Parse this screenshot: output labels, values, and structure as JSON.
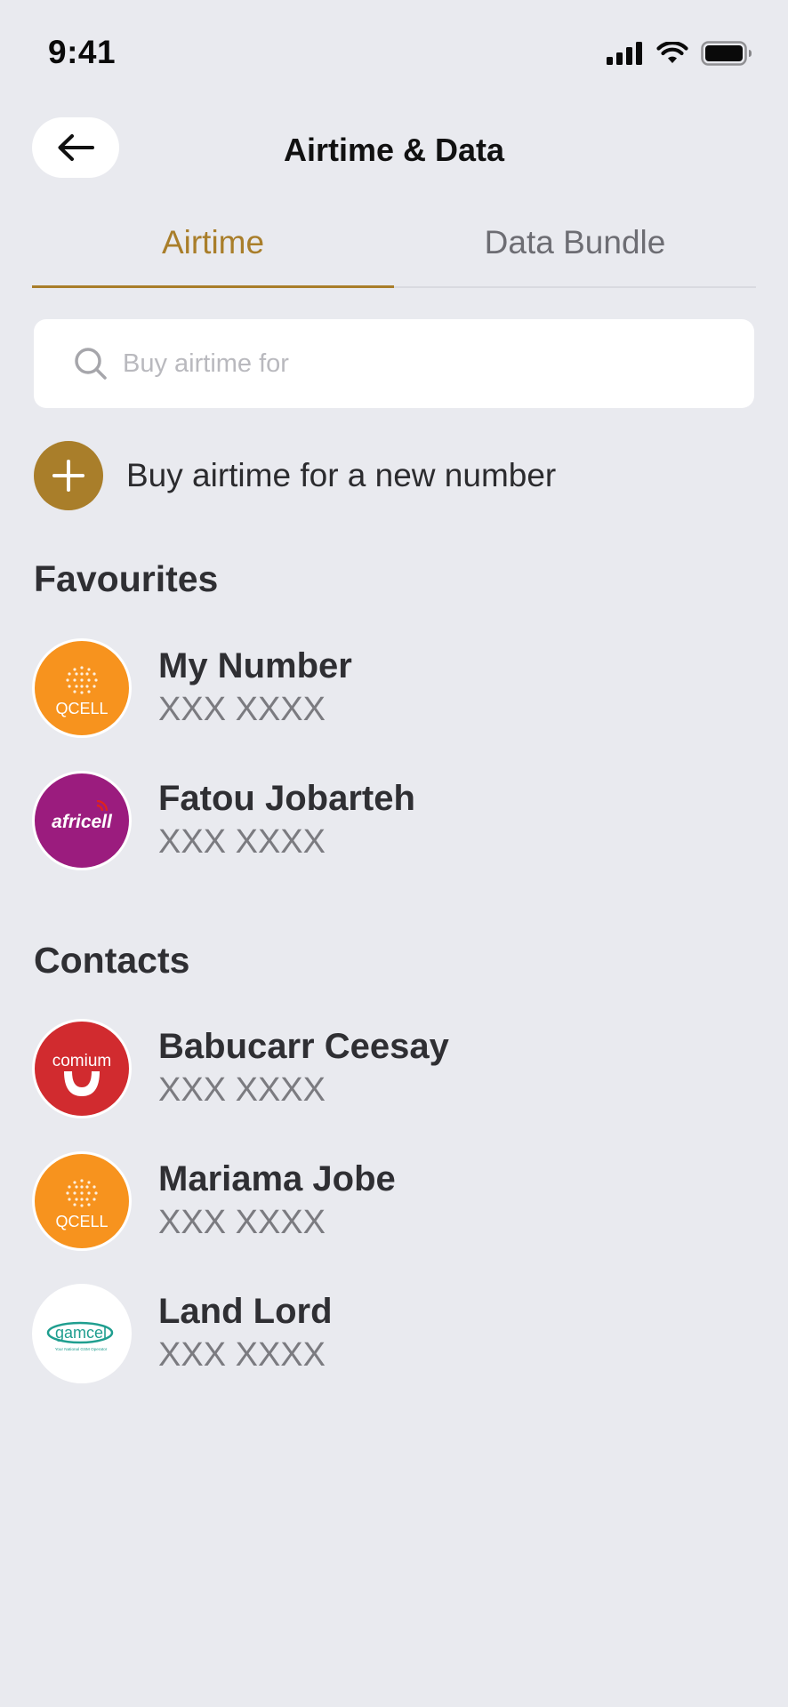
{
  "status": {
    "time": "9:41"
  },
  "header": {
    "title": "Airtime & Data"
  },
  "tabs": [
    {
      "label": "Airtime",
      "active": true
    },
    {
      "label": "Data Bundle",
      "active": false
    }
  ],
  "search": {
    "placeholder": "Buy airtime for",
    "value": ""
  },
  "new_number": {
    "label": "Buy airtime for a new number"
  },
  "favourites": {
    "title": "Favourites",
    "items": [
      {
        "name": "My Number",
        "number": "XXX XXXX",
        "operator": "QCELL"
      },
      {
        "name": "Fatou Jobarteh",
        "number": "XXX XXXX",
        "operator": "africell"
      }
    ]
  },
  "contacts": {
    "title": "Contacts",
    "items": [
      {
        "name": "Babucarr Ceesay",
        "number": "XXX XXXX",
        "operator": "comium"
      },
      {
        "name": "Mariama Jobe",
        "number": "XXX XXXX",
        "operator": "QCELL"
      },
      {
        "name": "Land Lord",
        "number": "XXX XXXX",
        "operator": "gamcel",
        "operator_tagline": "Your National GSM Operator"
      }
    ]
  },
  "colors": {
    "accent": "#a97e2a",
    "background": "#e9eaef",
    "qcell": "#f7931e",
    "africell": "#9b1c7e",
    "comium": "#d12b2f",
    "gamcel": "#1f9e8f"
  }
}
